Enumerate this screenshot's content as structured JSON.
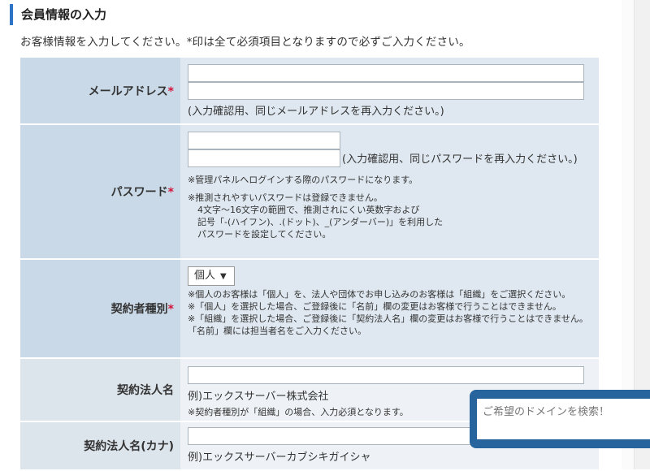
{
  "section_title": "会員情報の入力",
  "intro": "お客様情報を入力してください。*印は全て必須項目となりますので必ずご入力ください。",
  "required_mark": "*",
  "fields": {
    "email": {
      "label": "メールアドレス",
      "confirm_note": "(入力確認用、同じメールアドレスを再入力ください。)"
    },
    "password": {
      "label": "パスワード",
      "confirm_note": "(入力確認用、同じパスワードを再入力ください。)",
      "note1": "※管理パネルへログインする際のパスワードになります。",
      "note2_l1": "※推測されやすいパスワードは登録できません。",
      "note2_l2": "4文字～16文字の範囲で、推測されにくい英数字および",
      "note2_l3": "記号「-(ハイフン)、.(ドット)、_(アンダーバー)」を利用した",
      "note2_l4": "パスワードを設定してください。"
    },
    "contract_type": {
      "label": "契約者種別",
      "selected": "個人",
      "note1": "※個人のお客様は「個人」を、法人や団体でお申し込みのお客様は「組織」をご選択ください。",
      "note2": "※「個人」を選択した場合、ご登録後に「名前」欄の変更はお客様で行うことはできません。",
      "note3": "※「組織」を選択した場合、ご登録後に「契約法人名」欄の変更はお客様で行うことはできません。",
      "note4": "「名前」欄には担当者名をご入力ください。"
    },
    "corp_name": {
      "label": "契約法人名",
      "example": "例)エックスサーバー株式会社",
      "note": "※契約者種別が「組織」の場合、入力必須となります。"
    },
    "corp_name_kana": {
      "label": "契約法人名(カナ)",
      "example": "例)エックスサーバーカブシキガイシャ"
    }
  },
  "domain_search": {
    "placeholder": "ご希望のドメインを検索！"
  }
}
